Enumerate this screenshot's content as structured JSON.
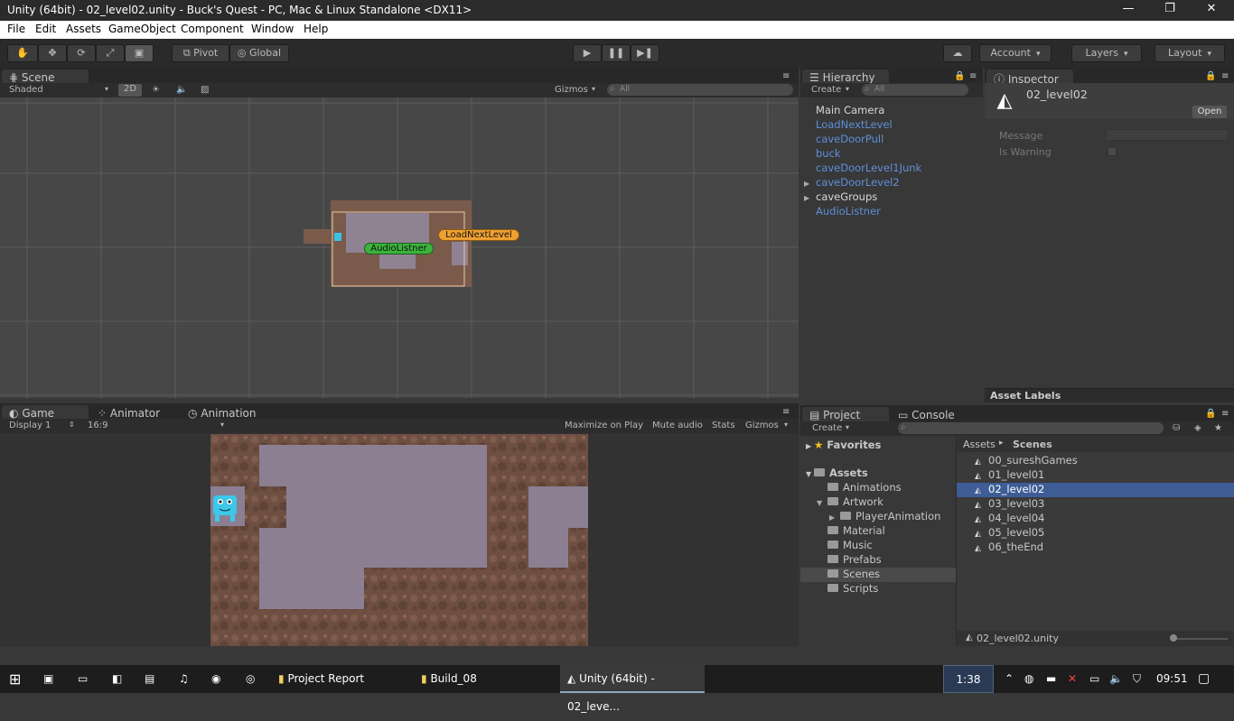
{
  "window": {
    "title": "Unity (64bit) - 02_level02.unity - Buck's Quest - PC, Mac & Linux Standalone <DX11>",
    "minimize": "—",
    "restore": "❐",
    "close": "✕"
  },
  "menu": [
    "File",
    "Edit",
    "Assets",
    "GameObject",
    "Component",
    "Window",
    "Help"
  ],
  "toolbar": {
    "pivot": "Pivot",
    "global": "Global",
    "account": "Account",
    "layers": "Layers",
    "layout": "Layout"
  },
  "scene": {
    "tab": "Scene",
    "shading": "Shaded",
    "mode2d": "2D",
    "gizmos": "Gizmos",
    "search_placeholder": "All",
    "labels": {
      "audio": "AudioListner",
      "load": "LoadNextLevel"
    }
  },
  "hierarchy": {
    "tab": "Hierarchy",
    "create": "Create",
    "search_placeholder": "All",
    "items": [
      {
        "label": "Main Camera",
        "color": "#d8d8d8",
        "arrow": ""
      },
      {
        "label": "LoadNextLevel",
        "color": "#5e8fd8",
        "arrow": ""
      },
      {
        "label": "caveDoorPull",
        "color": "#5e8fd8",
        "arrow": ""
      },
      {
        "label": "buck",
        "color": "#5e8fd8",
        "arrow": ""
      },
      {
        "label": "caveDoorLevel1Junk",
        "color": "#5e8fd8",
        "arrow": ""
      },
      {
        "label": "caveDoorLevel2",
        "color": "#5e8fd8",
        "arrow": "▶"
      },
      {
        "label": "caveGroups",
        "color": "#d8d8d8",
        "arrow": "▶"
      },
      {
        "label": "AudioListner",
        "color": "#5e8fd8",
        "arrow": ""
      }
    ]
  },
  "inspector": {
    "tab": "Inspector",
    "object_name": "02_level02",
    "open_button": "Open",
    "message_label": "Message",
    "warning_label": "Is Warning",
    "asset_labels": "Asset Labels"
  },
  "game": {
    "tab": "Game",
    "animator_tab": "Animator",
    "animation_tab": "Animation",
    "display": "Display 1",
    "aspect": "16:9",
    "maximize": "Maximize on Play",
    "mute": "Mute audio",
    "stats": "Stats",
    "gizmos": "Gizmos"
  },
  "project": {
    "tab": "Project",
    "console_tab": "Console",
    "create": "Create",
    "favorites": "Favorites",
    "assets": "Assets",
    "folders": [
      {
        "label": "Animations",
        "indent": 0,
        "arrow": ""
      },
      {
        "label": "Artwork",
        "indent": 0,
        "arrow": "▼"
      },
      {
        "label": "PlayerAnimation",
        "indent": 1,
        "arrow": "▶"
      },
      {
        "label": "Material",
        "indent": 0,
        "arrow": ""
      },
      {
        "label": "Music",
        "indent": 0,
        "arrow": ""
      },
      {
        "label": "Prefabs",
        "indent": 0,
        "arrow": ""
      },
      {
        "label": "Scenes",
        "indent": 0,
        "arrow": "",
        "selected": true
      },
      {
        "label": "Scripts",
        "indent": 0,
        "arrow": ""
      }
    ],
    "breadcrumb_root": "Assets",
    "breadcrumb_sep": "▸",
    "breadcrumb_current": "Scenes",
    "scenes": [
      {
        "label": "00_sureshGames",
        "selected": false
      },
      {
        "label": "01_level01",
        "selected": false
      },
      {
        "label": "02_level02",
        "selected": true
      },
      {
        "label": "03_level03",
        "selected": false
      },
      {
        "label": "04_level04",
        "selected": false
      },
      {
        "label": "05_level05",
        "selected": false
      },
      {
        "label": "06_theEnd",
        "selected": false
      }
    ],
    "footer": "02_level02.unity"
  },
  "taskbar": {
    "items": [
      "Project Report",
      "Build_08",
      "Unity (64bit) - 02_leve..."
    ],
    "ime": "1:38",
    "clock": "09:51"
  }
}
